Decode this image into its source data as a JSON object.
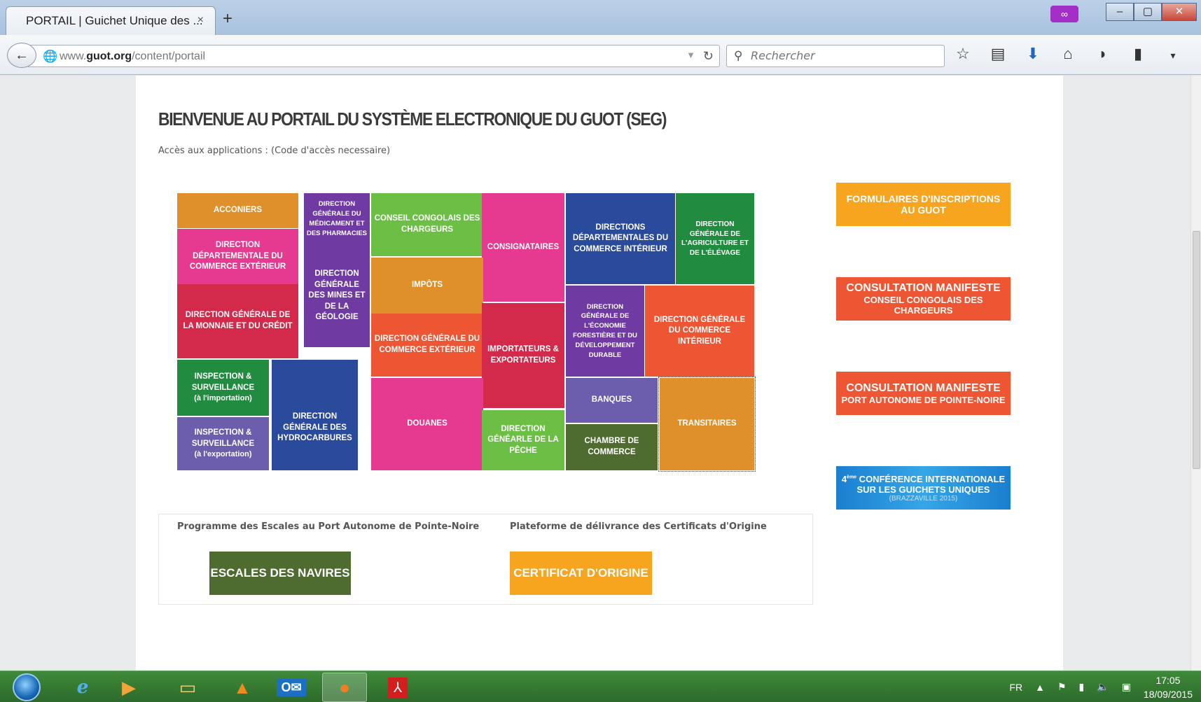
{
  "browser": {
    "tab_title": "PORTAIL | Guichet Unique des ...",
    "tab_close": "×",
    "new_tab": "+",
    "url_prefix": "www.",
    "url_host": "guot.org",
    "url_path": "/content/portail",
    "search_placeholder": "Rechercher",
    "icons": [
      "back-icon",
      "globe-icon",
      "reload-icon",
      "search-icon",
      "bookmark-star-icon",
      "reading-list-icon",
      "download-icon",
      "home-icon",
      "pocket-icon",
      "clipboard-icon",
      "menu-dropdown-icon",
      "hamburger-menu-icon"
    ]
  },
  "page": {
    "heading": "BIENVENUE AU PORTAIL DU SYSTÈME ELECTRONIQUE DU GUOT (SEG)",
    "subtitle": "Accès aux applications : (Code d'accès necessaire)",
    "tiles": {
      "acconiers": "ACCONIERS",
      "dg_medicament": "DIRECTION GÉNÉRALE DU MÉDICAMENT ET DES PHARMACIES",
      "conseil": "CONSEIL CONGOLAIS DES CHARGEURS",
      "consignataires": "CONSIGNATAIRES",
      "dir_dep_commerce_int": "DIRECTIONS DÉPARTEMENTALES DU COMMERCE INTÉRIEUR",
      "dg_agriculture": "DIRECTION GÉNÉRALE DE L'AGRICULTURE ET DE L'ÉLÉVAGE",
      "dd_commerce_ext": "DIRECTION DÉPARTEMENTALE DU COMMERCE EXTÉRIEUR",
      "dg_mines": "DIRECTION GÉNÉRALE DES MINES ET DE LA GÉOLOGIE",
      "impots": "IMPÔTS",
      "dg_monnaie": "DIRECTION GÉNÉRALE DE LA MONNAIE ET DU CRÉDIT",
      "dg_commerce_ext": "DIRECTION GÉNÉRALE DU COMMERCE EXTÉRIEUR",
      "importateurs": "IMPORTATEURS & EXPORTATEURS",
      "dg_economie_forestiere": "DIRECTION GÉNÉRALE DE L'ÉCONOMIE FORESTIÈRE ET DU DÉVELOPPEMENT DURABLE",
      "dg_commerce_int": "DIRECTION GÉNÉRALE DU COMMERCE INTÉRIEUR",
      "insp_import_1": "INSPECTION & SURVEILLANCE",
      "insp_import_2": "(à l'importation)",
      "dg_hydrocarbures": "DIRECTION GÉNÉRALE DES HYDROCARBURES",
      "douanes": "DOUANES",
      "banques": "BANQUES",
      "transitaires": "TRANSITAIRES",
      "insp_export_1": "INSPECTION & SURVEILLANCE",
      "insp_export_2": "(à l'exportation)",
      "dg_peche": "DIRECTION GÉNÉARLE DE LA PÊCHE",
      "chambre": "CHAMBRE DE COMMERCE"
    },
    "side": {
      "formulaires": "FORMULAIRES D'INSCRIPTIONS AU GUOT",
      "manifeste1_l1": "CONSULTATION MANIFESTE",
      "manifeste1_l2": "CONSEIL CONGOLAIS DES CHARGEURS",
      "manifeste2_l1": "CONSULTATION MANIFESTE",
      "manifeste2_l2": "PORT AUTONOME DE POINTE-NOIRE",
      "conference_sup": "ème",
      "conference_l1": "4",
      "conference_l1b": " CONFÉRENCE INTERNATIONALE",
      "conference_l2": "SUR LES GUICHETS UNIQUES",
      "conference_l3": "(BRAZZAVILLE 2015)"
    },
    "programme_label": "Programme des Escales au Port Autonome de Pointe-Noire",
    "escales_button": "ESCALES DES NAVIRES",
    "plateforme_label": "Plateforme de délivrance des Certificats d'Origine",
    "certificat_button": "CERTIFICAT D'ORIGINE"
  },
  "taskbar": {
    "apps": [
      "start-orb",
      "internet-explorer-icon",
      "media-player-icon",
      "file-explorer-icon",
      "vlc-icon",
      "outlook-icon",
      "firefox-icon",
      "acrobat-icon"
    ],
    "lang": "FR",
    "time": "17:05",
    "date": "18/09/2015"
  },
  "colors": {
    "orange": "#e0902a",
    "magenta": "#e63a91",
    "green": "#6cbf45",
    "navy": "#2a4a9b",
    "darkgreen": "#218c3f",
    "purple": "#6f3aa1",
    "crimson": "#d32a4b",
    "red_orange": "#ee5532",
    "lavender": "#6c5eac",
    "olive": "#4e6b30",
    "amber": "#f7a51f",
    "side_red": "#ee5532",
    "conference_blue": "#1d8fd6"
  }
}
